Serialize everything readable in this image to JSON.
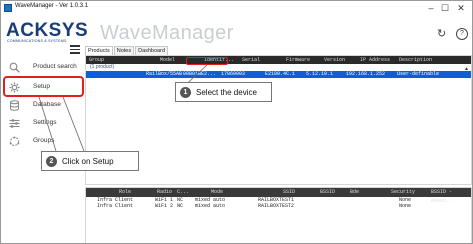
{
  "window": {
    "title": "WaveManager - Ver 1.0.3.1",
    "controls": {
      "minimize": "–",
      "maximize": "☐",
      "close": "✕"
    }
  },
  "header": {
    "logo_main": "ACKSYS",
    "logo_sub": "COMMUNICATIONS & SYSTEMS",
    "app_title": "WaveManager",
    "refresh_icon": "refresh-icon",
    "help_icon": "help-icon",
    "refresh_glyph": "↻",
    "help_glyph": "?"
  },
  "sidebar": {
    "items": [
      {
        "label": "Product search",
        "icon": "magnify-icon"
      },
      {
        "label": "Setup",
        "icon": "gear-icon"
      },
      {
        "label": "Database",
        "icon": "database-icon"
      },
      {
        "label": "Settings",
        "icon": "sliders-icon"
      },
      {
        "label": "Groups",
        "icon": "groups-icon"
      }
    ]
  },
  "main": {
    "tabs": [
      "Products",
      "Notes",
      "Dashboard"
    ],
    "grid": {
      "columns": [
        "Group",
        "Model",
        "Identif...",
        "Serial",
        "Firmware",
        "Version",
        "IP Address",
        "Description"
      ],
      "group_label": "(1 product)",
      "selected_row": [
        "RailBox/55AB",
        "00B01BE2...",
        "17060003",
        "E2100.4C.1",
        "5.12.10.1",
        "192.168.1.252",
        "User-definable"
      ]
    },
    "bottom_grid": {
      "columns": [
        "Role",
        "Radio",
        "C...",
        "Mode",
        "SSID",
        "BSSID",
        "Bde",
        "Security",
        "BSSID - Assoc..."
      ],
      "rows": [
        [
          "Infra Client",
          "WiFi 1",
          "NC",
          "mixed auto",
          "RAILBOXTEST1",
          "",
          "",
          "None",
          ""
        ],
        [
          "Infra Client",
          "WiFi 2",
          "NC",
          "mixed auto",
          "RAILBOXTEST2",
          "",
          "",
          "None",
          ""
        ]
      ]
    }
  },
  "annotations": {
    "step1": {
      "number": "1",
      "text": "Select the device"
    },
    "step2": {
      "number": "2",
      "text": "Click on Setup"
    }
  },
  "colors": {
    "brand": "#193d79",
    "selection": "#0d5fd6",
    "highlight": "#e02020"
  }
}
